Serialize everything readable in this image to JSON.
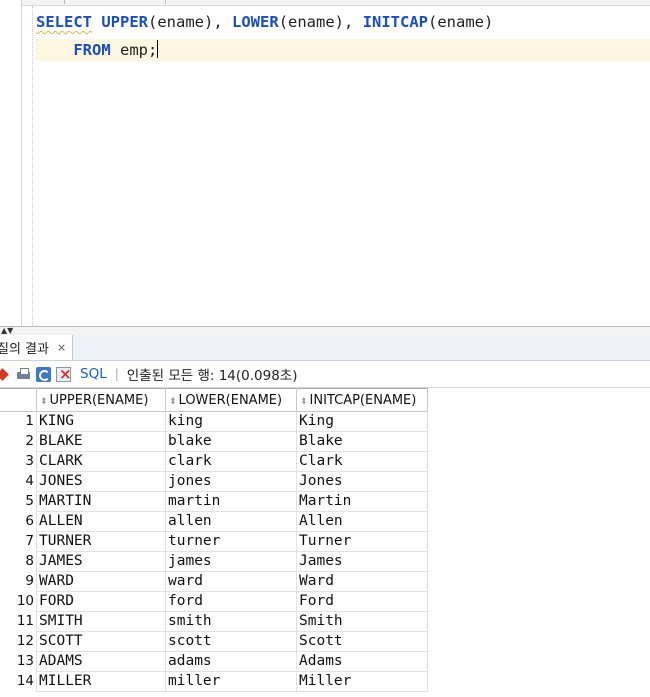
{
  "editor": {
    "line1": {
      "k1": "SELECT",
      "f1": "UPPER",
      "a1": "(ename), ",
      "f2": "LOWER",
      "a2": "(ename), ",
      "f3": "INITCAP",
      "a3": "(ename)"
    },
    "line2": {
      "k1": "FROM",
      "rest": " emp;"
    }
  },
  "results_panel": {
    "tab_label": "질의 결과",
    "tab_close": "×",
    "toolbar": {
      "sql_label": "SQL",
      "separator": "|",
      "status": "인출된 모든 행: 14(0.098초)"
    }
  },
  "grid": {
    "columns": [
      "UPPER(ENAME)",
      "LOWER(ENAME)",
      "INITCAP(ENAME)"
    ],
    "rows": [
      {
        "n": "1",
        "upper": "KING",
        "lower": "king",
        "initcap": "King"
      },
      {
        "n": "2",
        "upper": "BLAKE",
        "lower": "blake",
        "initcap": "Blake"
      },
      {
        "n": "3",
        "upper": "CLARK",
        "lower": "clark",
        "initcap": "Clark"
      },
      {
        "n": "4",
        "upper": "JONES",
        "lower": "jones",
        "initcap": "Jones"
      },
      {
        "n": "5",
        "upper": "MARTIN",
        "lower": "martin",
        "initcap": "Martin"
      },
      {
        "n": "6",
        "upper": "ALLEN",
        "lower": "allen",
        "initcap": "Allen"
      },
      {
        "n": "7",
        "upper": "TURNER",
        "lower": "turner",
        "initcap": "Turner"
      },
      {
        "n": "8",
        "upper": "JAMES",
        "lower": "james",
        "initcap": "James"
      },
      {
        "n": "9",
        "upper": "WARD",
        "lower": "ward",
        "initcap": "Ward"
      },
      {
        "n": "10",
        "upper": "FORD",
        "lower": "ford",
        "initcap": "Ford"
      },
      {
        "n": "11",
        "upper": "SMITH",
        "lower": "smith",
        "initcap": "Smith"
      },
      {
        "n": "12",
        "upper": "SCOTT",
        "lower": "scott",
        "initcap": "Scott"
      },
      {
        "n": "13",
        "upper": "ADAMS",
        "lower": "adams",
        "initcap": "Adams"
      },
      {
        "n": "14",
        "upper": "MILLER",
        "lower": "miller",
        "initcap": "Miller"
      }
    ]
  },
  "colors": {
    "keyword": "#1c4fb5",
    "current_line": "#fdf7e2",
    "sql_link": "#1f5fbf"
  },
  "icons": [
    "pin-icon",
    "print-icon",
    "refresh-icon",
    "export-icon",
    "sort-icon",
    "close-icon"
  ]
}
